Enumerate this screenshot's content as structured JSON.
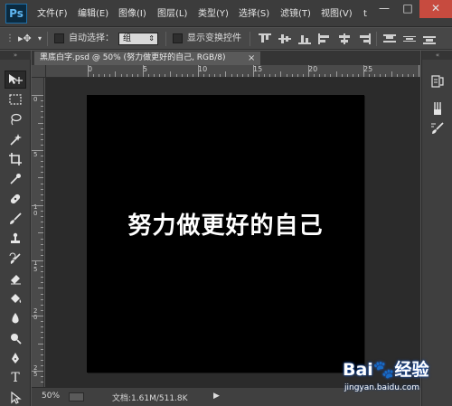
{
  "app": {
    "logo": "Ps"
  },
  "menu": [
    {
      "label": "文件(F)"
    },
    {
      "label": "编辑(E)"
    },
    {
      "label": "图像(I)"
    },
    {
      "label": "图层(L)"
    },
    {
      "label": "类型(Y)"
    },
    {
      "label": "选择(S)"
    },
    {
      "label": "滤镜(T)"
    },
    {
      "label": "视图(V)"
    },
    {
      "label": "t"
    }
  ],
  "window_controls": {
    "minimize": "—",
    "restore": "□",
    "close": "✕"
  },
  "options_bar": {
    "auto_select_label": "自动选择：",
    "auto_select_value": "组",
    "show_transform_label": "显示变换控件"
  },
  "document_tab": {
    "title": "黑底白字.psd @ 50% (努力做更好的自己, RGB/8)",
    "close": "×"
  },
  "rulers": {
    "top_labels": [
      "0",
      "5",
      "10",
      "15",
      "20",
      "25"
    ],
    "left_labels": [
      "0",
      "5",
      "1 0",
      "1 5",
      "2 0",
      "2 5"
    ]
  },
  "canvas": {
    "text": "努力做更好的自己",
    "background": "#000000",
    "text_color": "#ffffff"
  },
  "status_bar": {
    "zoom": "50%",
    "doc_info": "文档:1.61M/511.8K",
    "arrow": "▶"
  },
  "watermark": {
    "logo": "Bai🐾经验",
    "url": "jingyan.baidu.com"
  },
  "colors": {
    "menubar": "#3c3c3c",
    "panel": "#3f3f3f",
    "workspace": "#2b2b2b",
    "accent_close": "#c74b3f"
  }
}
